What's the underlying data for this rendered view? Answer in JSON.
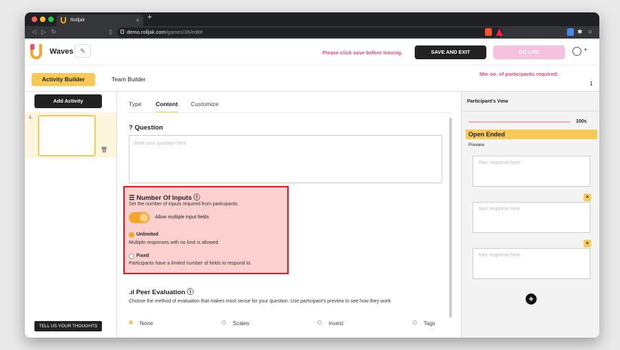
{
  "browser": {
    "tab_title": "Rolljak",
    "tab_close": "×",
    "new_tab": "+",
    "url_host": "demo.rolljak.com",
    "url_path": "/games/36/edit#",
    "colors": {
      "close": "#ff5f57",
      "minimize": "#febc2e",
      "maximize": "#28c840"
    }
  },
  "header": {
    "app_name": "Waves",
    "warning": "Please click save before leaving.",
    "save_exit": "SAVE AND EXIT",
    "go_live": "GO LIVE",
    "min_participants_label": "Min no. of participants required:",
    "min_participants_value": "1"
  },
  "builder_tabs": {
    "activity": "Activity Builder",
    "team": "Team Builder"
  },
  "sidebar": {
    "add_activity": "Add Activity",
    "slot_number": "1.",
    "feedback": "TELL US YOUR THOUGHTS"
  },
  "content_tabs": [
    "Type",
    "Content",
    "Customize"
  ],
  "question": {
    "title": "? Question",
    "placeholder": "Write your question here"
  },
  "number_of_inputs": {
    "title": "Number Of Inputs ⓘ",
    "description": "Set the number of inputs required from participants.",
    "toggle_label": "Allow multiple input fields",
    "toggle_on": true,
    "unlimited_label": "Unlimited",
    "unlimited_desc": "Multiple responses with no limit is allowed.",
    "fixed_label": "Fixed",
    "fixed_desc": "Participants have a limited number of fields to respond to."
  },
  "peer_evaluation": {
    "title": "Peer Evaluation ⓘ",
    "description": "Choose the method of evaluation that makes most sense for your question. Use participant's preview to see how they work.",
    "options": [
      "None",
      "Scales",
      "Invest",
      "Tags"
    ],
    "selected": "None"
  },
  "participant_view": {
    "title": "Participant's View",
    "timer": "100s",
    "type": "Open Ended",
    "preview": "Preview",
    "response_placeholder": "Your response here",
    "remove": "×",
    "add": "+"
  },
  "accent_colors": {
    "yellow": "#f7ca57",
    "pink": "#ea4c7a",
    "orange": "#f4a62a",
    "highlight_border": "#e3141c"
  }
}
